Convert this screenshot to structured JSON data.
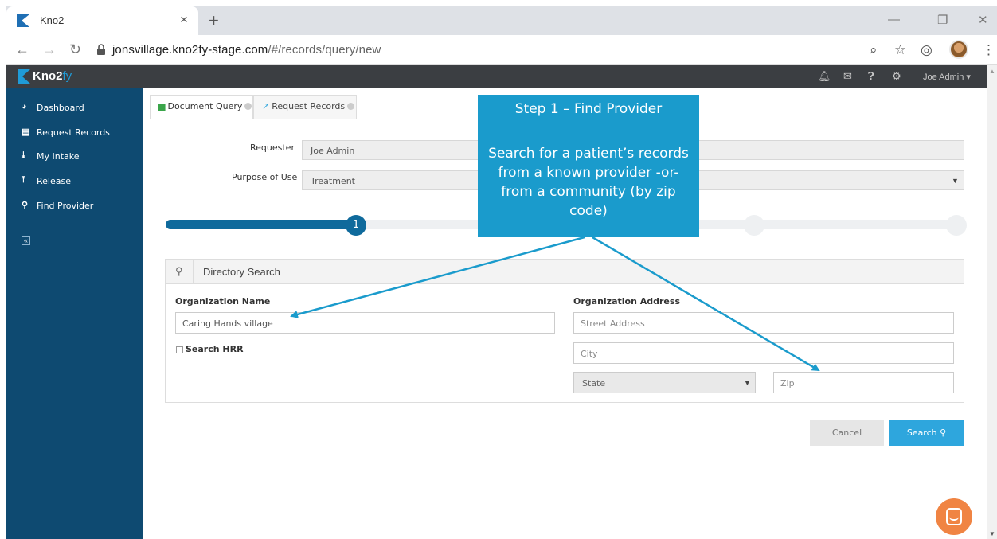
{
  "browser": {
    "tab_title": "Kno2",
    "tab_close": "×",
    "new_tab": "+",
    "url_host": "jonsvillage.kno2fy-stage.com",
    "url_path": "/#/records/query/new",
    "window_min": "—",
    "window_restore": "❐",
    "window_close": "✕"
  },
  "app": {
    "logo_main": "Kno2",
    "logo_suffix": "fy",
    "user_menu": "Joe Admin ▾",
    "brand_color": "#0e4a71",
    "accent_color": "#2ea6dd"
  },
  "sidebar": {
    "items": [
      {
        "label": "Dashboard",
        "icon": "dashboard-icon"
      },
      {
        "label": "Request Records",
        "icon": "request-records-icon"
      },
      {
        "label": "My Intake",
        "icon": "intake-icon"
      },
      {
        "label": "Release",
        "icon": "release-icon"
      },
      {
        "label": "Find Provider",
        "icon": "search-icon"
      }
    ],
    "collapse": "«"
  },
  "tabs": [
    {
      "label": "Document Query"
    },
    {
      "label": "Request Records"
    }
  ],
  "form": {
    "requester_label": "Requester",
    "requester_value": "Joe Admin",
    "purpose_label": "Purpose of Use",
    "purpose_value": "Treatment",
    "step_current": "1",
    "steps_total": 4
  },
  "directory": {
    "title": "Directory Search",
    "org_name_label": "Organization Name",
    "org_name_value": "Caring Hands village",
    "search_hrr_label": "Search HRR",
    "org_address_label": "Organization Address",
    "street_placeholder": "Street Address",
    "city_placeholder": "City",
    "state_placeholder": "State",
    "zip_placeholder": "Zip"
  },
  "buttons": {
    "cancel": "Cancel",
    "search": "Search"
  },
  "callout": {
    "heading": "Step 1 – Find Provider",
    "body": "Search for a patient’s records from a known provider -or- from a community (by zip code)"
  }
}
